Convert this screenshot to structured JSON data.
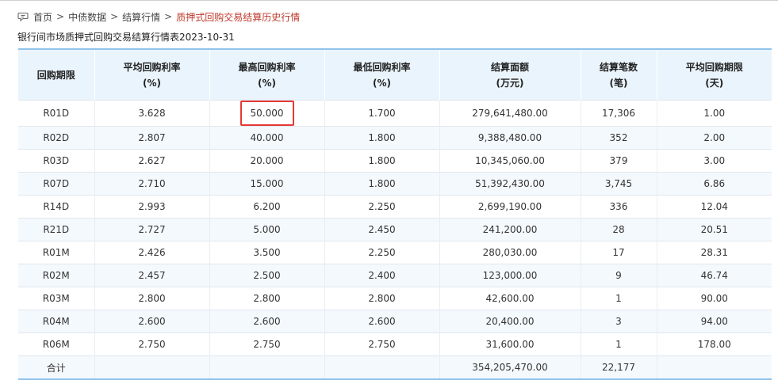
{
  "breadcrumb": {
    "home": "首页",
    "level2": "中债数据",
    "level3": "结算行情",
    "current": "质押式回购交易结算历史行情",
    "separator": ">"
  },
  "subtitle": "银行间市场质押式回购交易结算行情表2023-10-31",
  "colors": {
    "header_bg": "#eaf4fc",
    "table_border": "#8fc3ea",
    "current_crumb": "#c0392b",
    "highlight_box": "#e53935"
  },
  "table": {
    "headers": [
      {
        "line1": "回购期限",
        "line2": ""
      },
      {
        "line1": "平均回购利率",
        "line2": "(%)"
      },
      {
        "line1": "最高回购利率",
        "line2": "(%)"
      },
      {
        "line1": "最低回购利率",
        "line2": "(%)"
      },
      {
        "line1": "结算面额",
        "line2": "(万元)"
      },
      {
        "line1": "结算笔数",
        "line2": "(笔)"
      },
      {
        "line1": "平均回购期限",
        "line2": "(天)"
      }
    ],
    "rows": [
      [
        "R01D",
        "3.628",
        "50.000",
        "1.700",
        "279,641,480.00",
        "17,306",
        "1.00"
      ],
      [
        "R02D",
        "2.807",
        "40.000",
        "1.800",
        "9,388,480.00",
        "352",
        "2.00"
      ],
      [
        "R03D",
        "2.627",
        "20.000",
        "1.800",
        "10,345,060.00",
        "379",
        "3.00"
      ],
      [
        "R07D",
        "2.710",
        "15.000",
        "1.800",
        "51,392,430.00",
        "3,745",
        "6.86"
      ],
      [
        "R14D",
        "2.993",
        "6.200",
        "2.250",
        "2,699,190.00",
        "336",
        "12.04"
      ],
      [
        "R21D",
        "2.727",
        "5.000",
        "2.450",
        "241,200.00",
        "28",
        "20.51"
      ],
      [
        "R01M",
        "2.426",
        "3.500",
        "2.250",
        "280,030.00",
        "17",
        "28.31"
      ],
      [
        "R02M",
        "2.457",
        "2.500",
        "2.400",
        "123,000.00",
        "9",
        "46.74"
      ],
      [
        "R03M",
        "2.800",
        "2.800",
        "2.800",
        "42,600.00",
        "1",
        "90.00"
      ],
      [
        "R04M",
        "2.600",
        "2.600",
        "2.600",
        "20,400.00",
        "3",
        "94.00"
      ],
      [
        "R06M",
        "2.750",
        "2.750",
        "2.750",
        "31,600.00",
        "1",
        "178.00"
      ]
    ],
    "total": [
      "合计",
      "",
      "",
      "",
      "354,205,470.00",
      "22,177",
      ""
    ],
    "highlighted_cell": {
      "row": 0,
      "col": 2
    }
  }
}
